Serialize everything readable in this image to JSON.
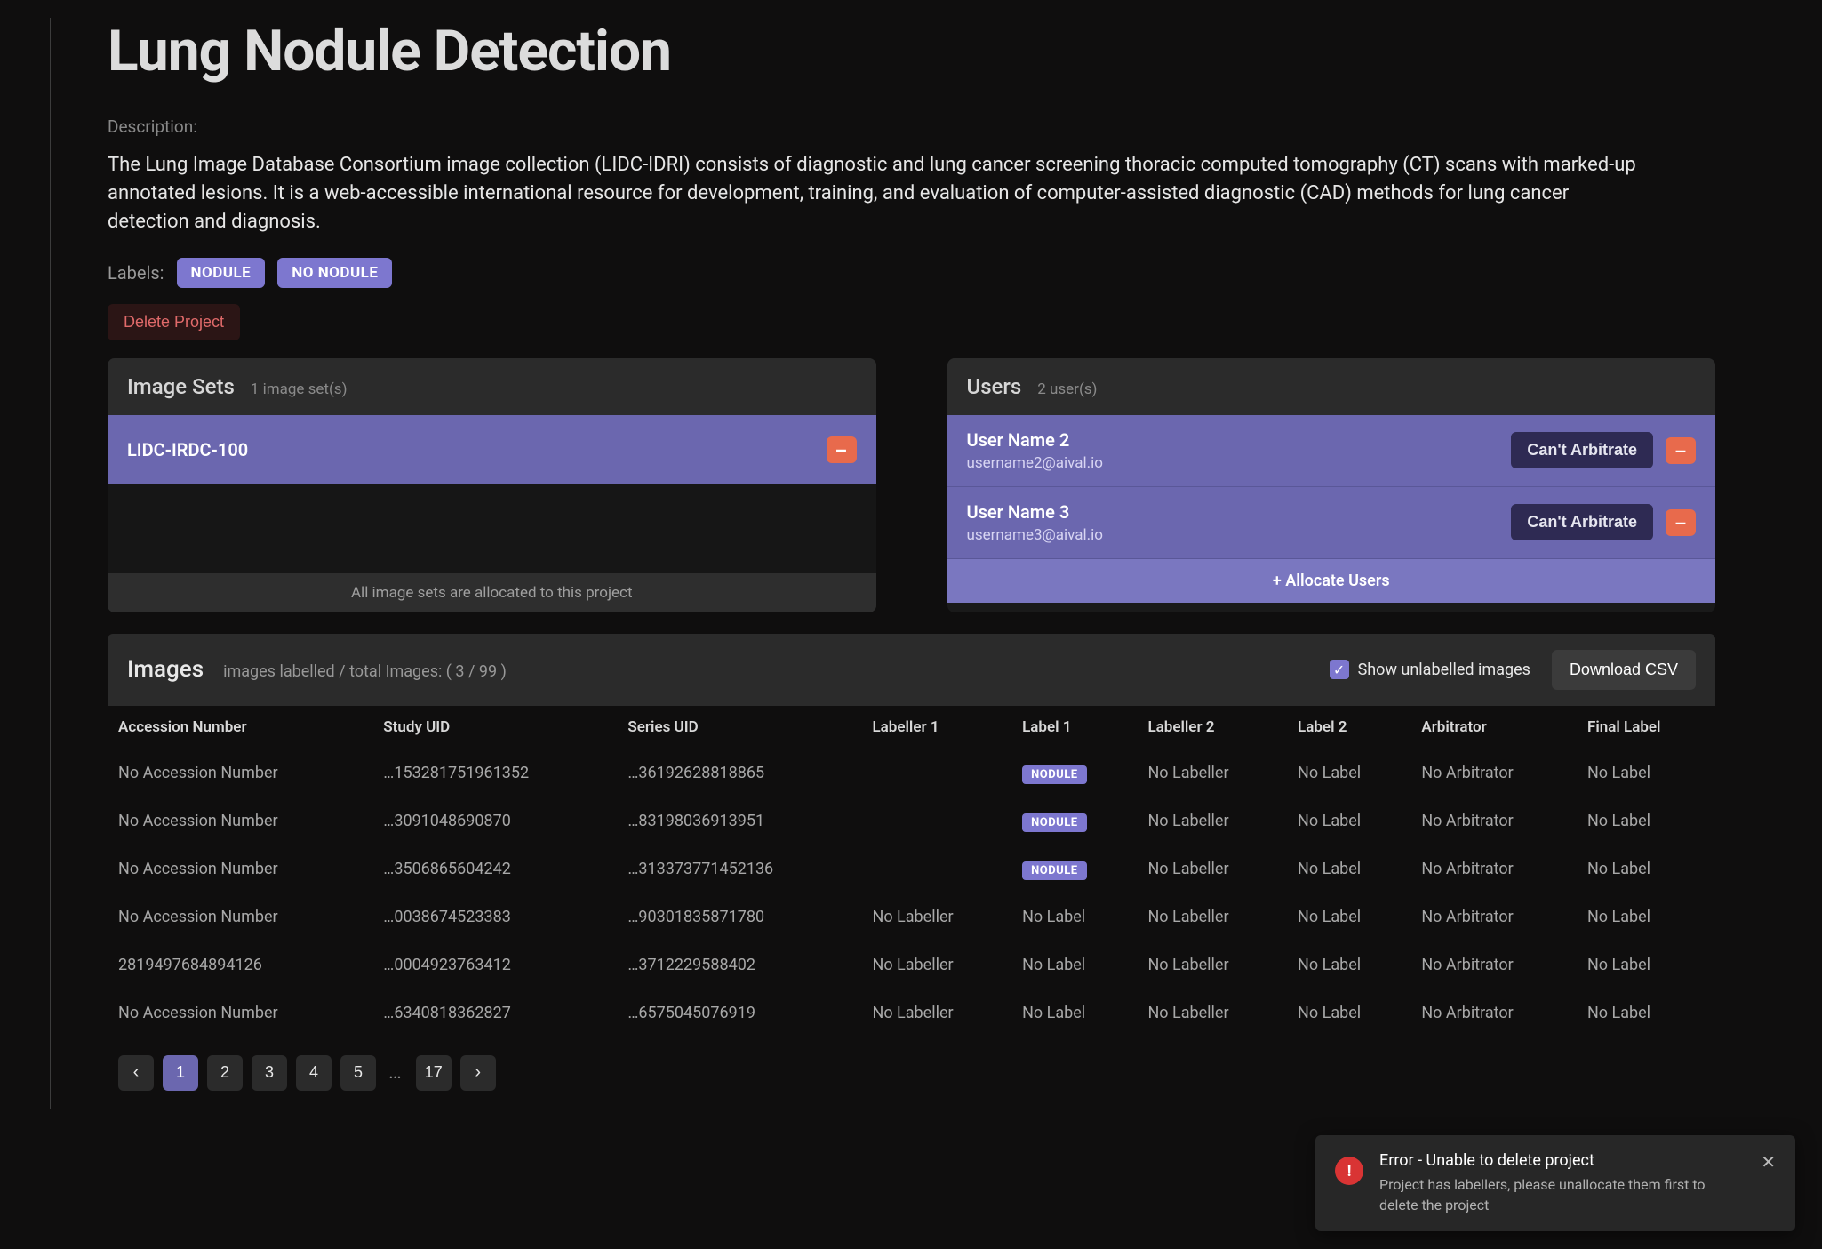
{
  "title": "Lung Nodule Detection",
  "description_label": "Description:",
  "description": "The Lung Image Database Consortium image collection (LIDC-IDRI) consists of diagnostic and lung cancer screening thoracic computed tomography (CT) scans with marked-up annotated lesions. It is a web-accessible international resource for development, training, and evaluation of computer-assisted diagnostic (CAD) methods for lung cancer detection and diagnosis.",
  "labels_title": "Labels:",
  "labels": [
    "NODULE",
    "NO NODULE"
  ],
  "delete_project": "Delete Project",
  "image_sets": {
    "title": "Image Sets",
    "count": "1 image set(s)",
    "items": [
      {
        "name": "LIDC-IRDC-100"
      }
    ],
    "footer": "All image sets are allocated to this project"
  },
  "users": {
    "title": "Users",
    "count": "2 user(s)",
    "items": [
      {
        "name": "User Name 2",
        "email": "username2@aival.io",
        "arb": "Can't Arbitrate"
      },
      {
        "name": "User Name 3",
        "email": "username3@aival.io",
        "arb": "Can't Arbitrate"
      }
    ],
    "allocate": "+ Allocate Users"
  },
  "images": {
    "title": "Images",
    "sub": "images labelled / total Images: ( 3 / 99 )",
    "show_unlabelled": "Show unlabelled images",
    "download": "Download CSV",
    "columns": [
      "Accession Number",
      "Study UID",
      "Series UID",
      "Labeller 1",
      "Label 1",
      "Labeller 2",
      "Label 2",
      "Arbitrator",
      "Final Label"
    ],
    "rows": [
      {
        "acc": "No Accession Number",
        "study": "…153281751961352",
        "series": "…36192628818865",
        "l1": "",
        "lab1": "NODULE",
        "l2": "No Labeller",
        "lab2": "No Label",
        "arb": "No Arbitrator",
        "final": "No Label"
      },
      {
        "acc": "No Accession Number",
        "study": "…3091048690870",
        "series": "…83198036913951",
        "l1": "",
        "lab1": "NODULE",
        "l2": "No Labeller",
        "lab2": "No Label",
        "arb": "No Arbitrator",
        "final": "No Label"
      },
      {
        "acc": "No Accession Number",
        "study": "…3506865604242",
        "series": "…313373771452136",
        "l1": "",
        "lab1": "NODULE",
        "l2": "No Labeller",
        "lab2": "No Label",
        "arb": "No Arbitrator",
        "final": "No Label"
      },
      {
        "acc": "No Accession Number",
        "study": "…0038674523383",
        "series": "…90301835871780",
        "l1": "No Labeller",
        "lab1": "No Label",
        "l2": "No Labeller",
        "lab2": "No Label",
        "arb": "No Arbitrator",
        "final": "No Label"
      },
      {
        "acc": "2819497684894126",
        "study": "…0004923763412",
        "series": "…3712229588402",
        "l1": "No Labeller",
        "lab1": "No Label",
        "l2": "No Labeller",
        "lab2": "No Label",
        "arb": "No Arbitrator",
        "final": "No Label"
      },
      {
        "acc": "No Accession Number",
        "study": "…6340818362827",
        "series": "…6575045076919",
        "l1": "No Labeller",
        "lab1": "No Label",
        "l2": "No Labeller",
        "lab2": "No Label",
        "arb": "No Arbitrator",
        "final": "No Label"
      }
    ],
    "pager": {
      "pages": [
        "1",
        "2",
        "3",
        "4",
        "5"
      ],
      "ellipsis": "…",
      "last": "17",
      "active": "1"
    }
  },
  "toast": {
    "title": "Error - Unable to delete project",
    "msg": "Project has labellers, please unallocate them first to delete the project"
  }
}
